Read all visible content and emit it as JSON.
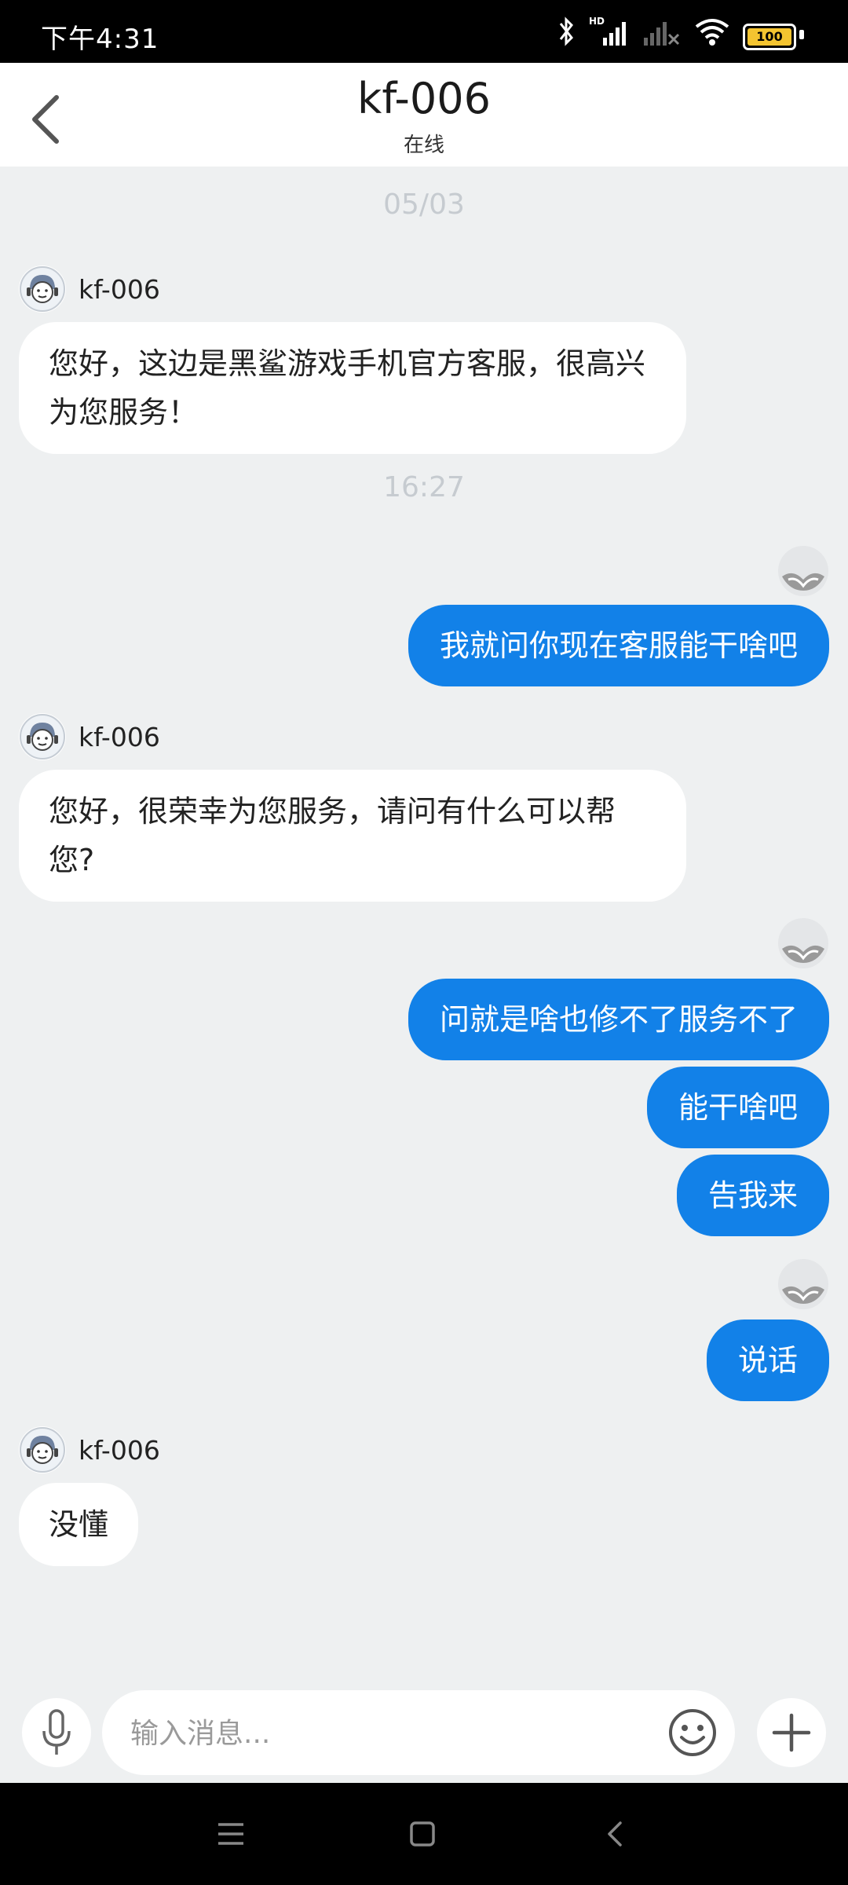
{
  "status_bar": {
    "time": "下午4:31",
    "battery": "100",
    "network_label": "HD"
  },
  "header": {
    "title": "kf-006",
    "status": "在线"
  },
  "chat": {
    "timestamps": [
      "05/03",
      "16:27"
    ],
    "agent_name": "kf-006",
    "messages": [
      {
        "from": "agent",
        "text": "您好，这边是黑鲨游戏手机官方客服，很高兴为您服务！"
      },
      {
        "from": "user",
        "text": "我就问你现在客服能干啥吧"
      },
      {
        "from": "agent",
        "text": "您好，很荣幸为您服务，请问有什么可以帮您?"
      },
      {
        "from": "user",
        "text": "问就是啥也修不了服务不了"
      },
      {
        "from": "user",
        "text": "能干啥吧"
      },
      {
        "from": "user",
        "text": "告我来"
      },
      {
        "from": "user",
        "text": "说话"
      },
      {
        "from": "agent",
        "text": "没懂"
      }
    ]
  },
  "input": {
    "placeholder": "输入消息..."
  },
  "colors": {
    "accent": "#1281e8",
    "background": "#eef0f1"
  },
  "icons": [
    "back-icon",
    "mic-icon",
    "emoji-icon",
    "plus-icon",
    "menu-icon",
    "home-icon",
    "nav-back-icon"
  ]
}
